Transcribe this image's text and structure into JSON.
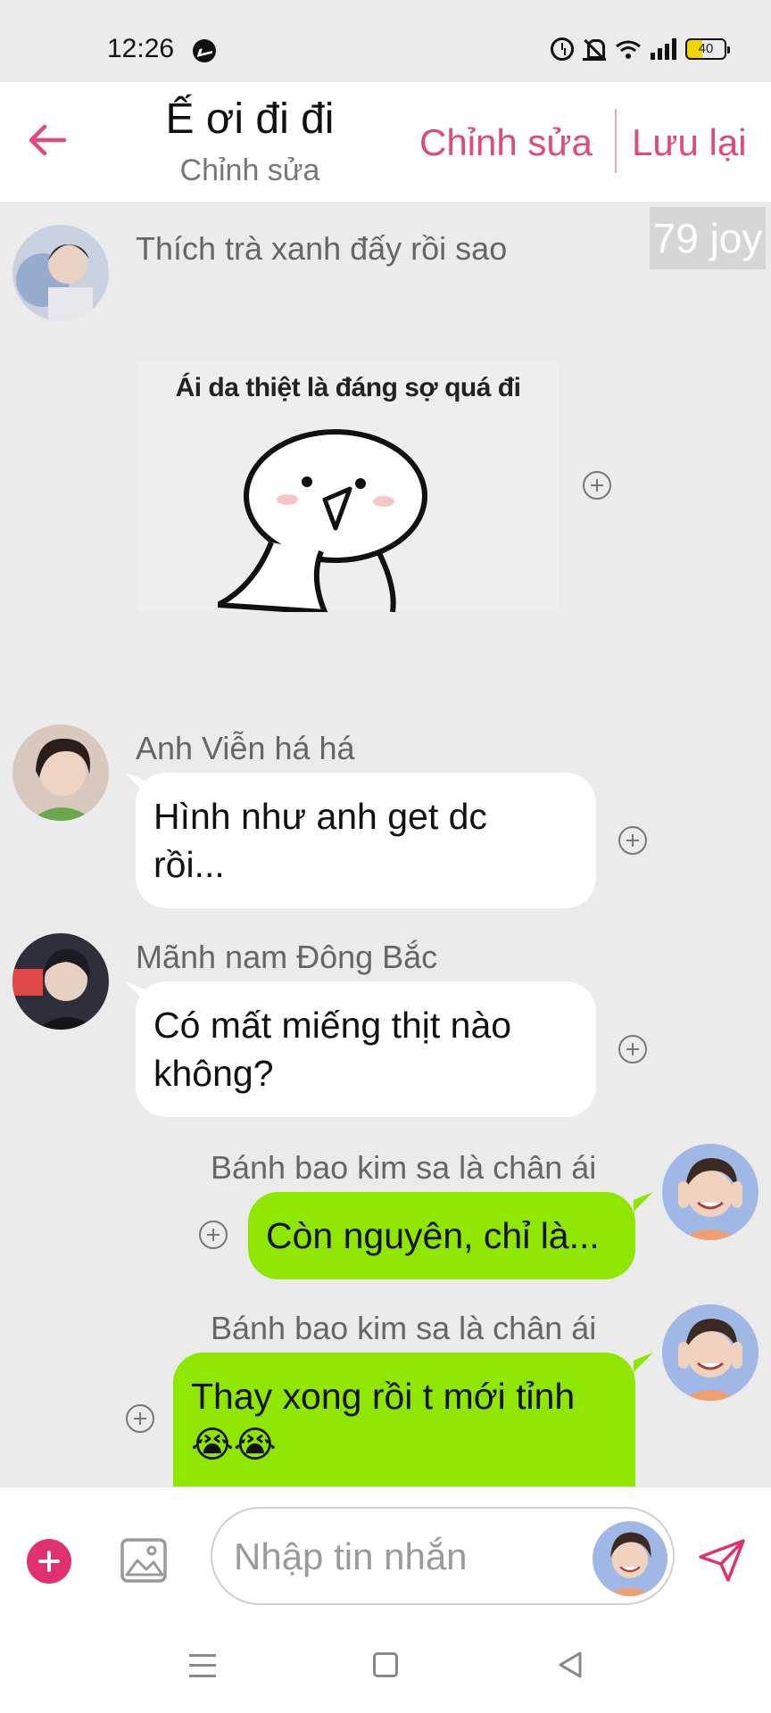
{
  "status_bar": {
    "time": "12:26",
    "battery": "40",
    "icons": [
      "messenger-icon",
      "alarm-icon",
      "mute-icon",
      "wifi-icon",
      "signal-icon",
      "battery-icon"
    ]
  },
  "header": {
    "title": "Ế ơi đi đi",
    "subtitle": "Chỉnh sửa",
    "edit_label": "Chỉnh sửa",
    "save_label": "Lưu lại",
    "accent_color": "#e0487f"
  },
  "watermark": "79 joy",
  "messages": [
    {
      "sender": "Thích trà xanh đấy rồi sao",
      "type": "sticker",
      "sticker_text": "Ái da thiệt là đáng sợ quá đi",
      "direction": "in"
    },
    {
      "sender": "Anh Viễn há há",
      "type": "text",
      "line1": "Hình như anh get dc",
      "line2": "rồi...",
      "direction": "in"
    },
    {
      "sender": "Mãnh nam Đông Bắc",
      "type": "text",
      "line1": "Có mất miếng thịt nào",
      "line2": "không?",
      "direction": "in"
    },
    {
      "sender": "Bánh bao kim sa là chân ái",
      "type": "text",
      "line1": "Còn nguyên, chỉ là...",
      "direction": "out"
    },
    {
      "sender": "Bánh bao kim sa là chân ái",
      "type": "text",
      "line1": "Thay xong rồi t mới tỉnh",
      "line2": "😭😭",
      "direction": "out"
    }
  ],
  "input": {
    "placeholder": "Nhập tin nhắn"
  },
  "colors": {
    "outgoing_bubble": "#8fe600",
    "incoming_bubble": "#ffffff",
    "background": "#ebebeb"
  }
}
